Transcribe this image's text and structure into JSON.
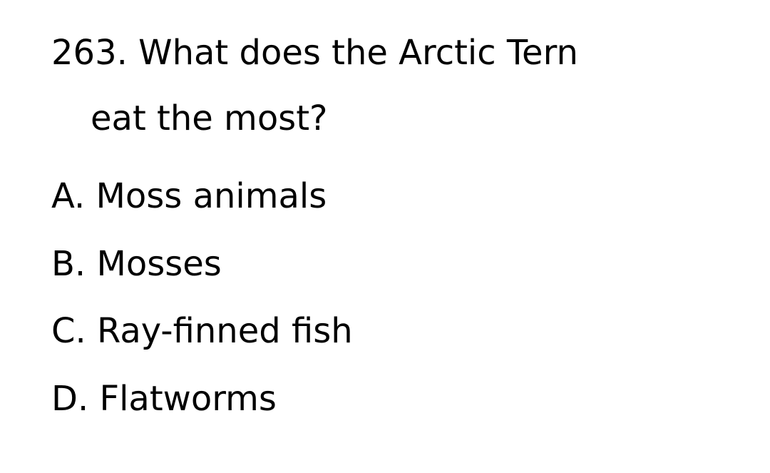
{
  "question": {
    "line1": "263. What does the Arctic Tern",
    "line2": "eat the most?"
  },
  "options": [
    "A. Moss animals",
    "B. Mosses",
    "C. Ray-finned fish",
    "D. Flatworms"
  ]
}
